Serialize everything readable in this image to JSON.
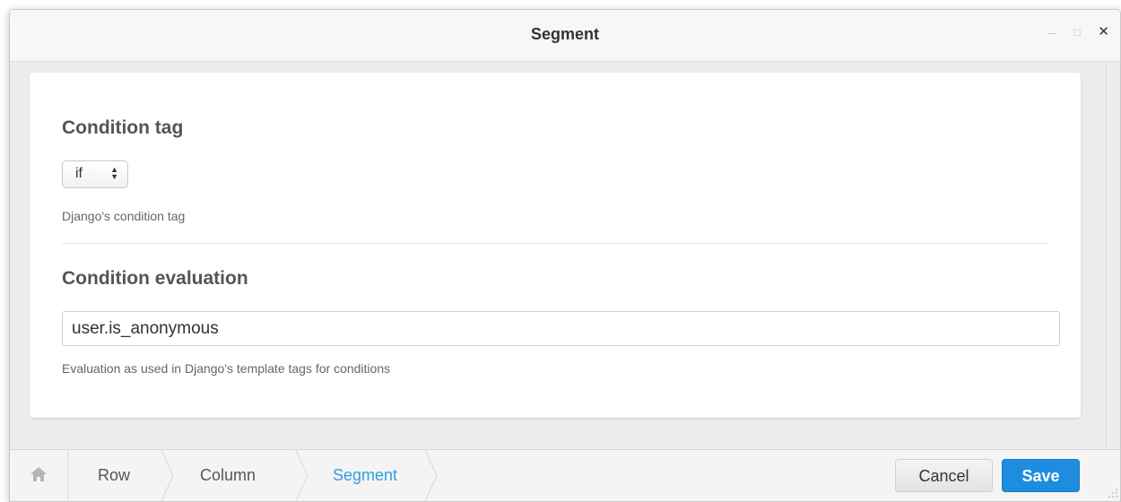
{
  "window": {
    "title": "Segment",
    "controls": {
      "minimize": "–",
      "maximize": "□",
      "close": "✕"
    }
  },
  "form": {
    "condition_tag": {
      "label": "Condition tag",
      "value": "if",
      "help": "Django's condition tag"
    },
    "condition_evaluation": {
      "label": "Condition evaluation",
      "value": "user.is_anonymous",
      "help": "Evaluation as used in Django's template tags for conditions"
    }
  },
  "footer": {
    "breadcrumbs": [
      {
        "label": "Row"
      },
      {
        "label": "Column"
      },
      {
        "label": "Segment",
        "active": true
      }
    ],
    "cancel_label": "Cancel",
    "save_label": "Save"
  },
  "colors": {
    "accent": "#2f9fe3",
    "save_button": "#1e8de0"
  },
  "icons": [
    "home-icon",
    "chevron-right-icon",
    "select-arrows-icon",
    "resize-grip-icon"
  ]
}
